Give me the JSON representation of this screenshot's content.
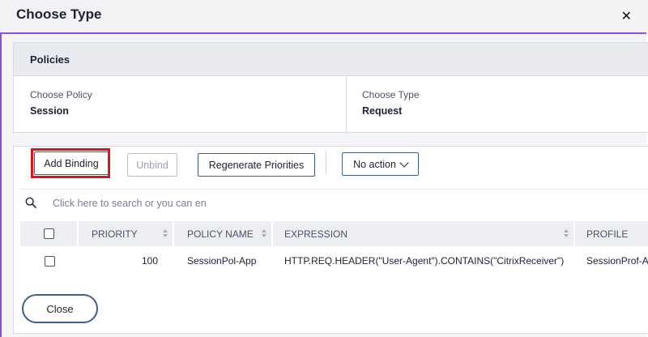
{
  "dialog": {
    "title": "Choose Type",
    "close_glyph": "✕"
  },
  "panel": {
    "header": "Policies",
    "fields": [
      {
        "label": "Choose Policy",
        "value": "Session"
      },
      {
        "label": "Choose Type",
        "value": "Request"
      }
    ]
  },
  "toolbar": {
    "add_binding": "Add Binding",
    "unbind": "Unbind",
    "regenerate": "Regenerate Priorities",
    "action_select": "No action"
  },
  "search": {
    "placeholder": "Click here to search or you can en"
  },
  "table": {
    "columns": [
      "PRIORITY",
      "POLICY NAME",
      "EXPRESSION",
      "PROFILE"
    ],
    "rows": [
      {
        "priority": "100",
        "policy_name": "SessionPol-App",
        "expression": "HTTP.REQ.HEADER(\"User-Agent\").CONTAINS(\"CitrixReceiver\")",
        "profile": "SessionProf-App"
      }
    ]
  },
  "footer": {
    "close": "Close"
  },
  "colors": {
    "accent_border": "#8a4fd6",
    "highlight": "#d9141b",
    "button_border": "#3f5f8a"
  },
  "icons": {
    "search": "search-icon",
    "close": "close-icon",
    "dropdown": "chevron-down-icon",
    "sort": "sort-icon"
  }
}
